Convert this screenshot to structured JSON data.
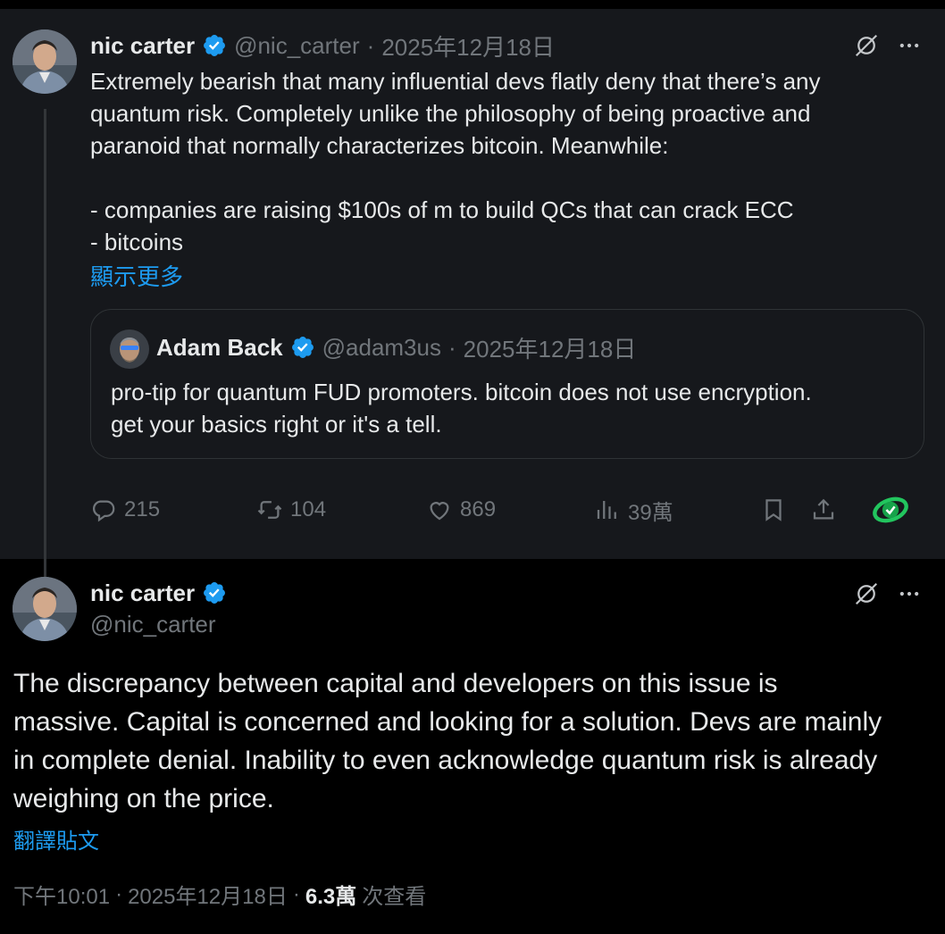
{
  "parent_tweet": {
    "author_name": "nic carter",
    "handle": "@nic_carter",
    "separator": "·",
    "date": "2025年12月18日",
    "text_lines": [
      "Extremely bearish that many influential devs flatly deny that there’s any",
      "quantum risk. Completely unlike the philosophy of being proactive and",
      "paranoid that normally characterizes bitcoin. Meanwhile:",
      "",
      "- companies are raising $100s of m to build QCs that can crack ECC",
      "- bitcoins"
    ],
    "show_more": "顯示更多",
    "quote": {
      "author_name": "Adam Back",
      "handle": "@adam3us",
      "separator": "·",
      "date": "2025年12月18日",
      "text_lines": [
        "pro-tip for quantum FUD promoters. bitcoin does not use encryption.",
        "get your basics right or it's a tell."
      ]
    },
    "actions": {
      "replies": "215",
      "reposts": "104",
      "likes": "869",
      "views": "39萬"
    }
  },
  "main_tweet": {
    "author_name": "nic carter",
    "handle": "@nic_carter",
    "text_lines": [
      "The discrepancy between capital and developers on this issue is",
      "massive. Capital is concerned and looking for a solution. Devs are mainly",
      "in complete denial. Inability to even acknowledge quantum risk is already",
      "weighing on the price."
    ],
    "translate": "翻譯貼文",
    "time": "下午10:01",
    "separator": "·",
    "date": "2025年12月18日",
    "separator2": "·",
    "views_count": "6.3萬",
    "views_label": "次查看"
  },
  "colors": {
    "verified": "#1d9bf0",
    "link": "#1d9bf0",
    "muted": "#71767b",
    "parent_bg": "#16181c",
    "extension_green": "#22c55e"
  },
  "icons": [
    "grok-icon",
    "more-icon",
    "reply-icon",
    "repost-icon",
    "like-icon",
    "views-icon",
    "bookmark-icon",
    "share-icon",
    "extension-icon",
    "verified-badge-icon"
  ]
}
